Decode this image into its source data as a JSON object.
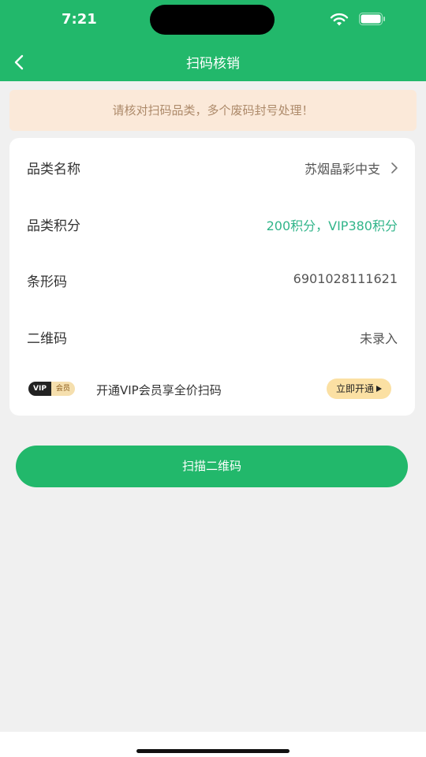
{
  "status_bar": {
    "time": "7:21"
  },
  "header": {
    "title": "扫码核销"
  },
  "notice": {
    "text": "请核对扫码品类，多个废码封号处理！"
  },
  "rows": [
    {
      "label": "品类名称",
      "value": "苏烟晶彩中支"
    },
    {
      "label": "品类积分",
      "value": "200积分，VIP380积分"
    },
    {
      "label": "条形码",
      "value": "6901028111621"
    },
    {
      "label": "二维码",
      "value": "未录入"
    }
  ],
  "vip": {
    "badge_vip": "VIP",
    "badge_member": "会员",
    "text": "开通VIP会员享全价扫码",
    "button": "立即开通"
  },
  "scan_button": {
    "label": "扫描二维码"
  },
  "colors": {
    "primary": "#22b86b",
    "notice_bg": "#fbe9d9",
    "notice_text": "#ad8a6a",
    "points_text": "#31b58a"
  },
  "icons": [
    "back-icon",
    "wifi-icon",
    "battery-icon",
    "chevron-right-icon",
    "play-icon"
  ]
}
